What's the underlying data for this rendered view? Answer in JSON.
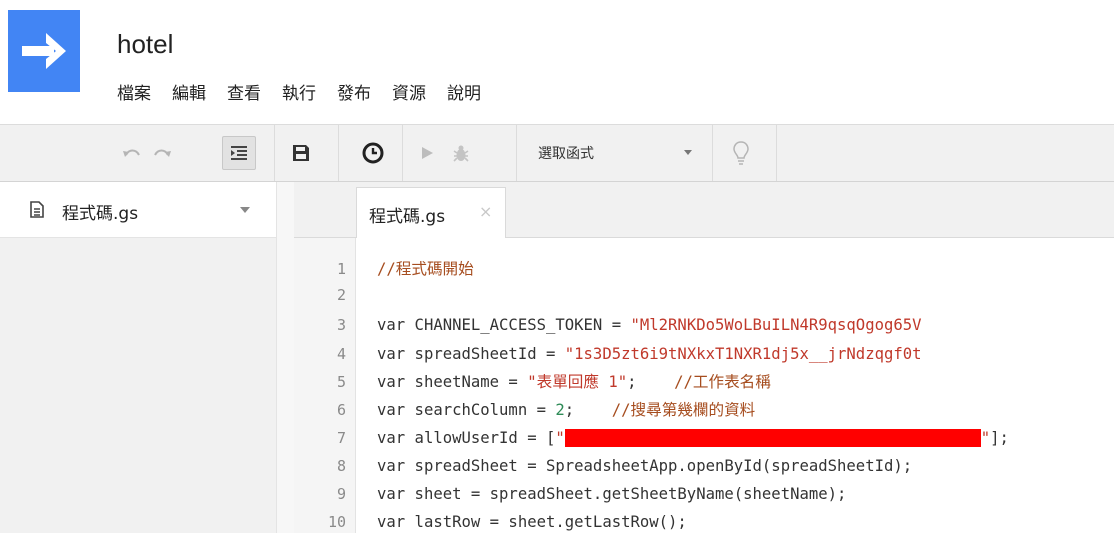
{
  "app": {
    "title": "hotel"
  },
  "menu": [
    "檔案",
    "編輯",
    "查看",
    "執行",
    "發布",
    "資源",
    "說明"
  ],
  "toolbar": {
    "function_select": "選取函式",
    "icons": [
      "undo-icon",
      "redo-icon",
      "indent-icon",
      "save-icon",
      "trigger-clock-icon",
      "run-icon",
      "debug-bug-icon",
      "lightbulb-icon"
    ]
  },
  "files": [
    {
      "name": "程式碼.gs"
    }
  ],
  "tabs": [
    {
      "label": "程式碼.gs",
      "close": "×"
    }
  ],
  "editor": {
    "line_numbers": [
      "1",
      "2",
      "3",
      "4",
      "5",
      "6",
      "7",
      "8",
      "9",
      "10"
    ],
    "lines": {
      "l1_comment": "//程式碼開始",
      "l3_code": "var CHANNEL_ACCESS_TOKEN = ",
      "l3_str": "\"Ml2RNKDo5WoLBuILN4R9qsqOgog65V",
      "l4_code": "var spreadSheetId = ",
      "l4_str": "\"1s3D5zt6i9tNXkxT1NXR1dj5x__jrNdzqgf0t",
      "l5_code": "var sheetName = ",
      "l5_str": "\"表單回應 1\"",
      "l5_semi": ";    ",
      "l5_comment": "//工作表名稱",
      "l6_code": "var searchColumn = ",
      "l6_num": "2",
      "l6_semi": ";    ",
      "l6_comment": "//搜尋第幾欄的資料",
      "l7_code": "var allowUserId = [",
      "l7_str_open": "\"",
      "l7_str_close": "\"",
      "l7_end": "];",
      "l8_code": "var spreadSheet = SpreadsheetApp.openById(spreadSheetId);",
      "l9_code": "var sheet = spreadSheet.getSheetByName(sheetName);",
      "l10_code": "var lastRow = sheet.getLastRow();"
    }
  },
  "colors": {
    "logo": "#4285f4",
    "string": "#c0392b",
    "comment": "#a64d1f",
    "number": "#2e8b57",
    "redaction": "#ff0000"
  }
}
